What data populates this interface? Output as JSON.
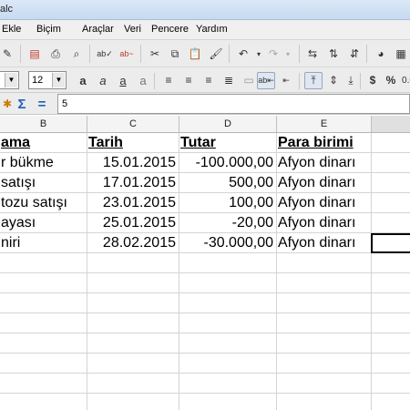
{
  "window": {
    "title": "alc"
  },
  "menu": {
    "items": [
      "Ekle",
      "Biçim",
      "Araçlar",
      "Veri",
      "Pencere",
      "Yardım"
    ]
  },
  "toolbar": {
    "font_size": "12"
  },
  "formula": {
    "value": "5"
  },
  "columns": [
    {
      "id": "B",
      "label": "B"
    },
    {
      "id": "C",
      "label": "C"
    },
    {
      "id": "D",
      "label": "D"
    },
    {
      "id": "E",
      "label": "E"
    }
  ],
  "sheet": {
    "headers": {
      "b": "ama",
      "c": "Tarih",
      "d": "Tutar",
      "e": "Para birimi"
    },
    "rows": [
      {
        "b": "r bükme",
        "c": "15.01.2015",
        "d": "-100.000,00",
        "e": "Afyon dinarı"
      },
      {
        "b": "satışı",
        "c": "17.01.2015",
        "d": "500,00",
        "e": "Afyon dinarı"
      },
      {
        "b": "tozu satışı",
        "c": "23.01.2015",
        "d": "100,00",
        "e": "Afyon dinarı"
      },
      {
        "b": "ayası",
        "c": "25.01.2015",
        "d": "-20,00",
        "e": "Afyon dinarı"
      },
      {
        "b": "niri",
        "c": "28.02.2015",
        "d": "-30.000,00",
        "e": "Afyon dinarı"
      }
    ]
  }
}
